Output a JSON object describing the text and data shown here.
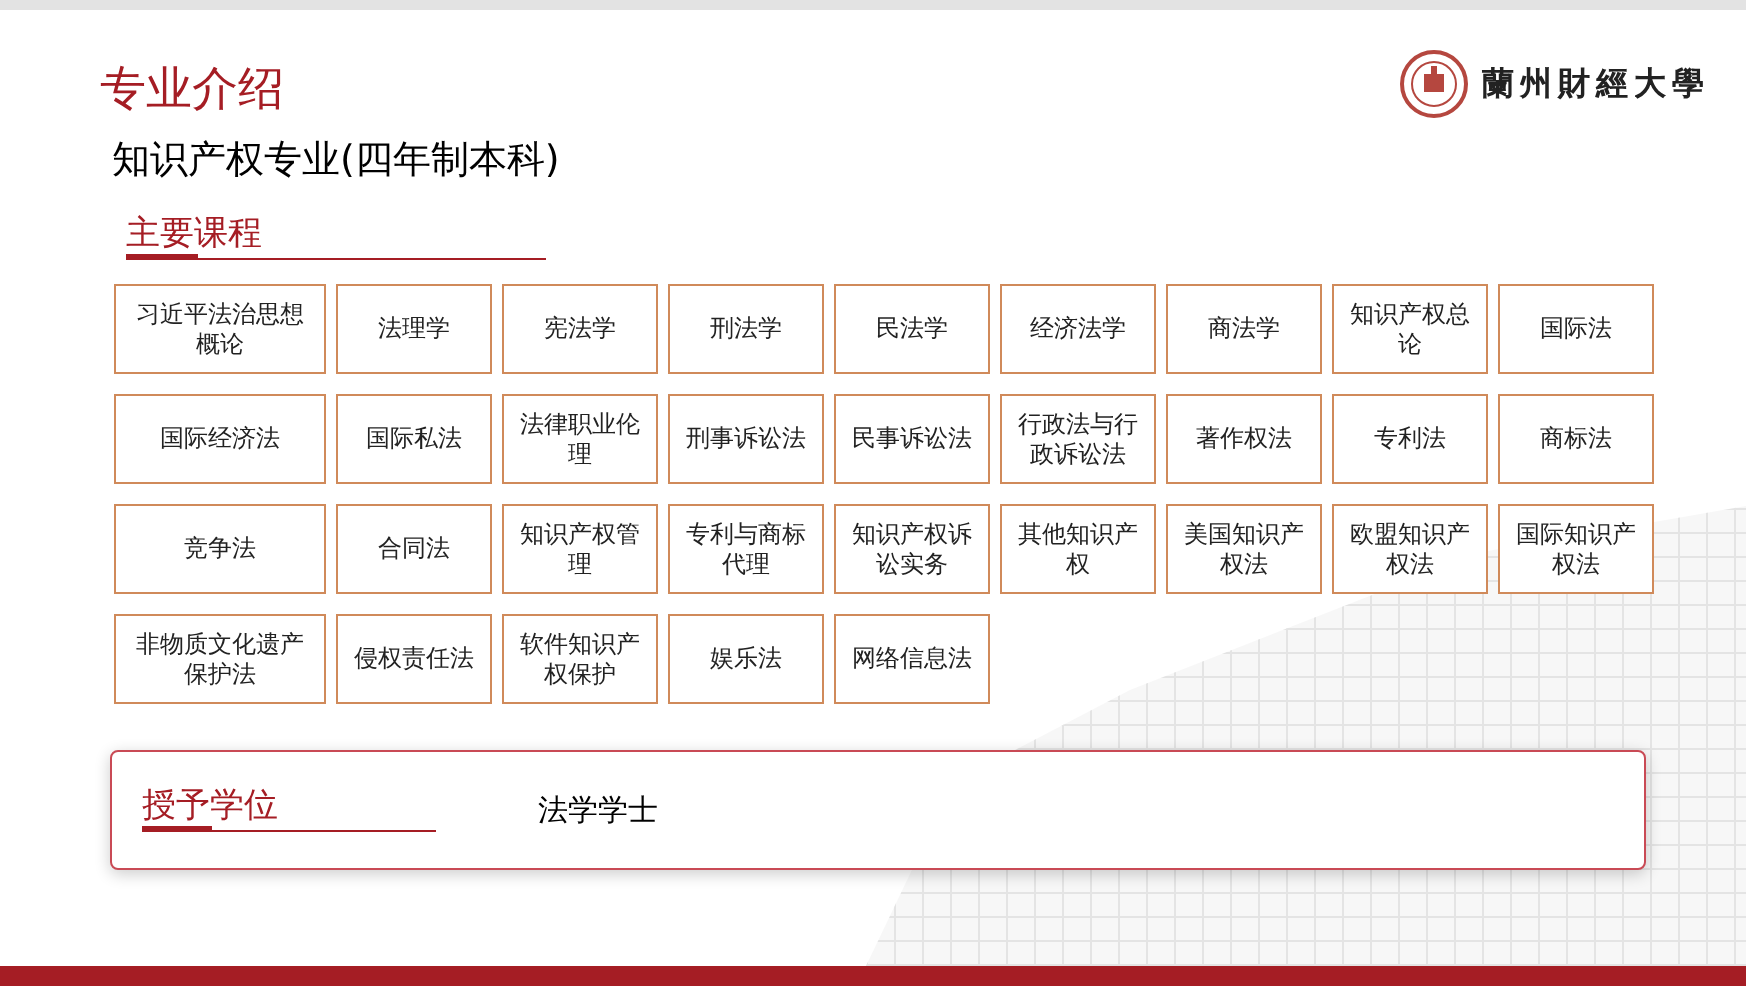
{
  "header": {
    "title": "专业介绍",
    "logo_text": "蘭州財經大學"
  },
  "subtitle": "知识产权专业(四年制本科)",
  "courses": {
    "heading": "主要课程",
    "rows": [
      [
        "习近平法治思想概论",
        "法理学",
        "宪法学",
        "刑法学",
        "民法学",
        "经济法学",
        "商法学",
        "知识产权总论",
        "国际法"
      ],
      [
        "国际经济法",
        "国际私法",
        "法律职业伦理",
        "刑事诉讼法",
        "民事诉讼法",
        "行政法与行政诉讼法",
        "著作权法",
        "专利法",
        "商标法"
      ],
      [
        "竞争法",
        "合同法",
        "知识产权管理",
        "专利与商标代理",
        "知识产权诉讼实务",
        "其他知识产权",
        "美国知识产权法",
        "欧盟知识产权法",
        "国际知识产权法"
      ],
      [
        "非物质文化遗产保护法",
        "侵权责任法",
        "软件知识产权保护",
        "娱乐法",
        "网络信息法"
      ]
    ]
  },
  "degree": {
    "heading": "授予学位",
    "value": "法学学士"
  }
}
